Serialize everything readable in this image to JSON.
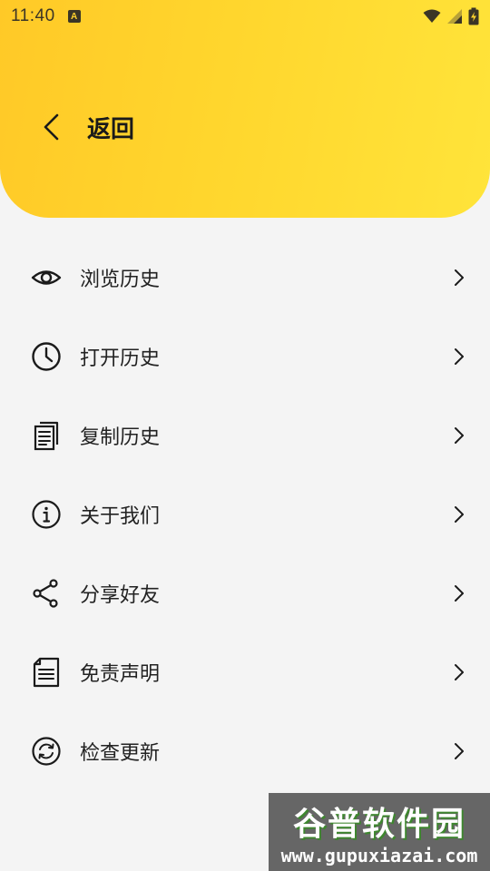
{
  "status_bar": {
    "time": "11:40",
    "notification_glyph": "A",
    "icons": [
      "wifi-icon",
      "signal-icon",
      "battery-charging-icon"
    ]
  },
  "header": {
    "back_label": "返回",
    "colors": {
      "gradient_start": "#ffc927",
      "gradient_end": "#ffe43a"
    }
  },
  "menu": {
    "items": [
      {
        "label": "浏览历史",
        "icon": "eye-icon"
      },
      {
        "label": "打开历史",
        "icon": "clock-icon"
      },
      {
        "label": "复制历史",
        "icon": "document-icon"
      },
      {
        "label": "关于我们",
        "icon": "info-icon"
      },
      {
        "label": "分享好友",
        "icon": "share-icon"
      },
      {
        "label": "免责声明",
        "icon": "note-icon"
      },
      {
        "label": "检查更新",
        "icon": "refresh-icon"
      }
    ]
  },
  "watermark": {
    "title": "谷普软件园",
    "url": "www.gupuxiazai.com"
  }
}
